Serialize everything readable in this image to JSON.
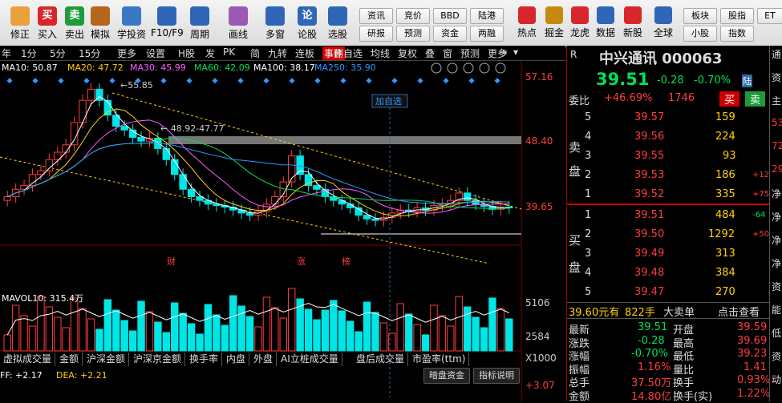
{
  "toolbar": {
    "buttons": [
      {
        "label": "修正",
        "icon": "refresh-icon",
        "color": "#e9a23b"
      },
      {
        "label": "买入",
        "icon": "buy-icon",
        "color": "#d8262c",
        "glyph": "买"
      },
      {
        "label": "卖出",
        "icon": "sell-icon",
        "color": "#1f9b3a",
        "glyph": "卖"
      },
      {
        "label": "模拟",
        "icon": "hammer-icon",
        "color": "#b5651d"
      },
      {
        "label": "学投资",
        "icon": "graduation-cap-icon",
        "color": "#3a78c4"
      },
      {
        "label": "F10/F9",
        "icon": "f10-icon",
        "color": "#2f66b7"
      },
      {
        "label": "周期",
        "icon": "clock-icon",
        "color": "#2f66b7"
      },
      {
        "label": "画线",
        "icon": "pencil-icon",
        "color": "#9b59b6"
      },
      {
        "label": "多窗",
        "icon": "multi-window-icon",
        "color": "#2f66b7"
      },
      {
        "label": "论股",
        "icon": "forum-icon",
        "color": "#2f66b7",
        "glyph": "论"
      },
      {
        "label": "选股",
        "icon": "stock-picker-icon",
        "color": "#2f66b7"
      }
    ],
    "small_buttons": [
      [
        "资讯",
        "研报"
      ],
      [
        "竞价",
        "预测"
      ],
      [
        "BBD",
        "资金"
      ],
      [
        "陆港",
        "两融"
      ]
    ],
    "right_buttons": [
      {
        "label": "热点",
        "icon": "hot-icon",
        "color": "#d8262c"
      },
      {
        "label": "掘金",
        "icon": "dig-icon",
        "color": "#c68a10"
      },
      {
        "label": "龙虎",
        "icon": "dragon-tiger-icon",
        "color": "#d8262c"
      },
      {
        "label": "数据",
        "icon": "data-icon",
        "color": "#2f66b7"
      },
      {
        "label": "新股",
        "icon": "ipo-icon",
        "color": "#d8262c"
      },
      {
        "label": "全球",
        "icon": "globe-icon",
        "color": "#2f66b7"
      }
    ],
    "far_small": [
      [
        "板块",
        "小股"
      ],
      [
        "股指",
        "指数"
      ],
      [
        "ET",
        ""
      ]
    ]
  },
  "strip": {
    "items": [
      "年",
      "1分",
      "5分",
      "15分",
      "更多",
      "设置"
    ],
    "items2": [
      "H股",
      "发",
      "PK",
      "简",
      "九转",
      "连板",
      "事件"
    ],
    "items3": [
      "删自选",
      "均线",
      "复权",
      "叠",
      "窗",
      "预测",
      "更多"
    ]
  },
  "indicators": {
    "ma10": "MA10: 50.87",
    "ma20": "MA20: 47.72",
    "ma30": "MA30: 45.99",
    "ma60": "MA60: 42.09",
    "ma100": "MA100: 38.17",
    "ma250": "MA250: 35.90"
  },
  "chart_data": {
    "type": "line",
    "title": "中兴通讯 000063",
    "price_axis": [
      "57.16",
      "48.40",
      "39.65"
    ],
    "volume_axis": [
      "5106",
      "2584",
      "X1000"
    ],
    "annotations": {
      "high": "55.85",
      "gap": "48.92-47.77",
      "add_fav": "加自选",
      "cai": "财",
      "zhang": "涨",
      "bang": "榜"
    },
    "ylim": [
      30,
      60
    ]
  },
  "volume": {
    "label": "MAVOL10: 315.4万"
  },
  "macd": {
    "dif": "FF: +2.17",
    "dea": "DEA: +2.21",
    "right_value": "+3.07"
  },
  "tabs": [
    "虚拟成交量",
    "金额",
    "沪深金额",
    "沪深京金额",
    "换手率",
    "内盘",
    "外盘",
    "AI立桩成交量",
    "盘后成交量",
    "市盈率(ttm)"
  ],
  "lower_buttons": [
    "暗盘资金",
    "指标说明"
  ],
  "quote": {
    "name": "中兴通讯",
    "code": "000063",
    "price": "39.51",
    "change": "-0.28",
    "pct": "-0.70%",
    "tag": "陆",
    "r_label": "R",
    "weibi_label": "委比",
    "weibi": "+46.69%",
    "weibi_n": "1746",
    "buy": "买",
    "sell": "卖",
    "sell_label": [
      "卖",
      "盘"
    ],
    "buy_label": [
      "买",
      "盘"
    ],
    "asks": [
      {
        "lvl": "5",
        "price": "39.57",
        "vol": "159",
        "chg": ""
      },
      {
        "lvl": "4",
        "price": "39.56",
        "vol": "224",
        "chg": ""
      },
      {
        "lvl": "3",
        "price": "39.55",
        "vol": "93",
        "chg": ""
      },
      {
        "lvl": "2",
        "price": "39.53",
        "vol": "186",
        "chg": "+12"
      },
      {
        "lvl": "1",
        "price": "39.52",
        "vol": "335",
        "chg": "+75"
      }
    ],
    "bids": [
      {
        "lvl": "1",
        "price": "39.51",
        "vol": "484",
        "chg": "-64"
      },
      {
        "lvl": "2",
        "price": "39.50",
        "vol": "1292",
        "chg": "+50"
      },
      {
        "lvl": "3",
        "price": "39.49",
        "vol": "313",
        "chg": ""
      },
      {
        "lvl": "4",
        "price": "39.48",
        "vol": "384",
        "chg": ""
      },
      {
        "lvl": "5",
        "price": "39.47",
        "vol": "270",
        "chg": ""
      }
    ],
    "bigsell": "39.60元有",
    "bigsell_n": "822手",
    "bigsell_l": "大卖单",
    "check": "点击查看",
    "stats": [
      [
        "最新",
        "39.51",
        "开盘",
        "39.59"
      ],
      [
        "涨跌",
        "-0.28",
        "最高",
        "39.69"
      ],
      [
        "涨幅",
        "-0.70%",
        "最低",
        "39.23"
      ],
      [
        "振幅",
        "1.16%",
        "量比",
        "1.41"
      ],
      [
        "总手",
        "37.50万",
        "换手",
        "0.93%"
      ],
      [
        "金额",
        "14.80亿",
        "换手(实)",
        "1.22%"
      ]
    ]
  },
  "farright": [
    "通",
    "资",
    "主",
    "53",
    "72",
    "29",
    "净",
    "净",
    "净",
    "净",
    "资",
    "能",
    "低",
    "资",
    "动"
  ]
}
